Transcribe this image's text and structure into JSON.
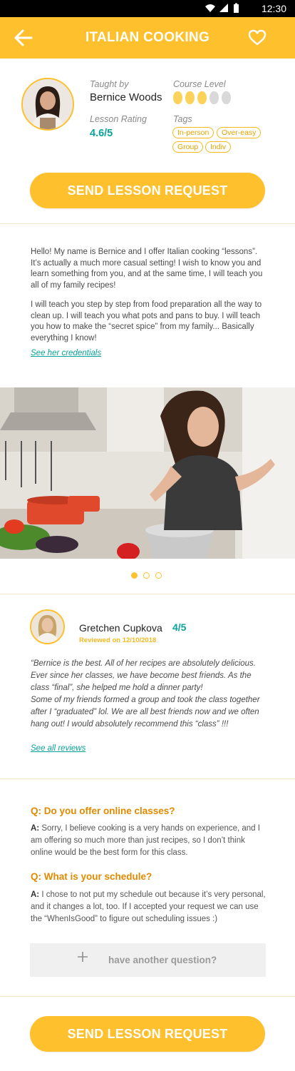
{
  "status_bar": {
    "time": "12:30",
    "icons": [
      "wifi-icon",
      "signal-icon",
      "battery-icon"
    ]
  },
  "app_bar": {
    "title": "ITALIAN COOKING",
    "back_icon": "arrow-left-icon",
    "favorite_icon": "heart-outline-icon"
  },
  "teacher": {
    "taught_by_label": "Taught by",
    "name": "Bernice Woods",
    "lesson_rating_label": "Lesson Rating",
    "rating": "4.6/5",
    "course_level_label": "Course Level",
    "course_level": {
      "filled": 3,
      "total": 5
    },
    "tags_label": "Tags",
    "tags": [
      "In-person",
      "Over-easy",
      "Group",
      "Indiv"
    ]
  },
  "cta": {
    "label": "SEND LESSON REQUEST"
  },
  "bio": {
    "paragraph1": "Hello! My name is Bernice and I offer Italian cooking “lessons”. It’s actually a much more casual setting! I wish to know you and learn something from you, and at the same time, I will teach you all of my family recipes!",
    "paragraph2": "I will teach you step by step from food preparation all the way to clean up. I will teach you what pots and pans to buy. I will teach you how to make the “secret spice” from my family... Basically everything I know!",
    "credentials_link": "See her credentials"
  },
  "gallery": {
    "total": 3,
    "active_index": 0
  },
  "review": {
    "reviewer": "Gretchen Cupkova",
    "score": "4/5",
    "date": "Reviewed on 12/10/2018",
    "text1": "“Bernice is the best. All of her recipes are absolutely delicious. Ever since her classes, we have become best friends. As the class “final”, she helped me hold a dinner party!",
    "text2": "Some of my friends formed a group and took the class together after I “graduated” lol. We are all best friends now and we often hang out! I would absolutely recommend this “class” !!!",
    "see_all": "See all reviews"
  },
  "faq": [
    {
      "q": "Q: Do you offer online classes?",
      "a_prefix": "A:",
      "a": " Sorry, I believe cooking is a very hands on experience, and I am offering so much more than just recipes, so I don’t think online would be the best form for this class."
    },
    {
      "q": "Q: What is your schedule?",
      "a_prefix": "A:",
      "a": " I chose to not put my schedule out because it’s very personal, and it changes a lot, too. If I accepted your request we can use the “WhenIsGood” to figure out scheduling issues :)"
    }
  ],
  "ask": {
    "label": "have another question?",
    "icon": "plus-icon"
  },
  "colors": {
    "accent": "#fec12d",
    "teal": "#0aa39a",
    "orange": "#e08a00"
  }
}
